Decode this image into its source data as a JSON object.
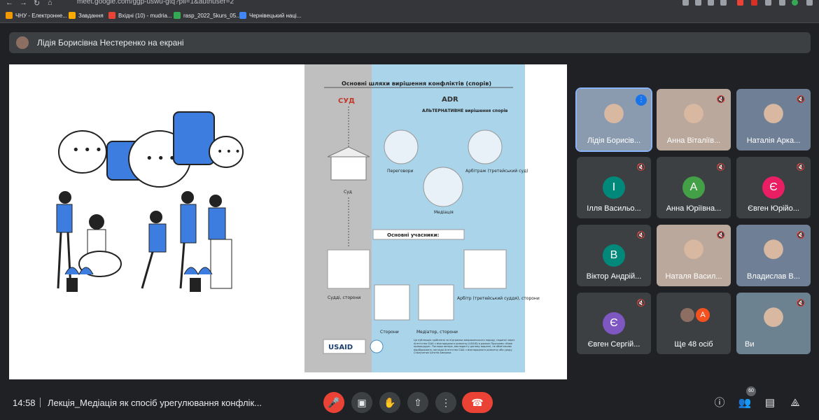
{
  "browser": {
    "url": "meet.google.com/ggp-uswu-gtq?pli=1&authuser=2",
    "bookmarks": [
      {
        "label": "ЧНУ - Електронне...",
        "color": "#f29900"
      },
      {
        "label": "Завдання",
        "color": "#f9ab00"
      },
      {
        "label": "Вхідні (10) - mudria...",
        "color": "#ea4335"
      },
      {
        "label": "rasp_2022_5kurs_05...",
        "color": "#34a853"
      },
      {
        "label": "Чернівецький наці...",
        "color": "#4285f4"
      }
    ]
  },
  "presentation_banner": {
    "text": "Лідія Борисівна Нестеренко на екрані"
  },
  "slide": {
    "title": "Основні шляхи вирішення конфліктів (спорів)",
    "court_label": "СУД",
    "adr_label": "ADR",
    "adr_sub": "АЛЬТЕРНАТИВНЕ вирішення спорів",
    "court_item": "Суд",
    "negotiations": "Переговори",
    "arbitration": "Арбітраж (третейський суд)",
    "mediation": "Медіація",
    "participants": "Основні учасники:",
    "judge_parties": "Судді, сторони",
    "arbiter_parties": "Арбітр (третейський суддя), сторони",
    "parties": "Сторони",
    "mediator_parties": "Медіатор, сторони",
    "usaid": "USAID",
    "footnote": "Ця публікація здійснена за підтримки американського народу, наданої через Агентство США з міжнародного розвитку (USAID) в рамках Програми «Нове правосуддя». Погляди автора, викладені у даному виданні, не обов'язково відображають погляди Агентства США з міжнародного розвитку або уряду Сполучених Штатів Америки."
  },
  "participants": [
    {
      "name": "Лідія Борисів...",
      "type": "photo",
      "active": true
    },
    {
      "name": "Анна Віталіїв...",
      "type": "photo"
    },
    {
      "name": "Наталія Арка...",
      "type": "photo"
    },
    {
      "name": "Ілля Васильо...",
      "letter": "І",
      "color": "#00897b"
    },
    {
      "name": "Анна Юріївна...",
      "letter": "А",
      "color": "#43a047"
    },
    {
      "name": "Євген Юрійо...",
      "letter": "Є",
      "color": "#e91e63"
    },
    {
      "name": "Віктор Андрій...",
      "letter": "В",
      "color": "#00897b"
    },
    {
      "name": "Наталя Васил...",
      "type": "photo"
    },
    {
      "name": "Владислав В...",
      "type": "photo"
    },
    {
      "name": "Євген Сергій...",
      "letter": "Є",
      "color": "#7e57c2"
    },
    {
      "name": "Ще 48 осіб",
      "letter": "А",
      "color": "#f4511e"
    },
    {
      "name": "Ви",
      "type": "photo"
    }
  ],
  "bottom": {
    "time": "14:58",
    "meeting": "Лекція_Медіація як спосіб урегулювання конфлік...",
    "people_count": "60"
  },
  "colors": {
    "accent": "#8ab4f8",
    "red": "#ea4335",
    "tile": "#3c4043"
  }
}
